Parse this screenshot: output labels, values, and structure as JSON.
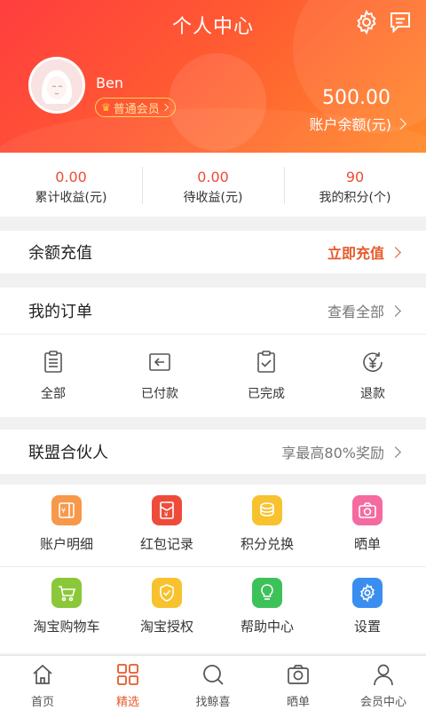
{
  "header": {
    "title": "个人中心",
    "username": "Ben",
    "member_level": "普通会员",
    "balance": "500.00",
    "balance_label": "账户余额(元)"
  },
  "stats": [
    {
      "value": "0.00",
      "label": "累计收益(元)"
    },
    {
      "value": "0.00",
      "label": "待收益(元)"
    },
    {
      "value": "90",
      "label": "我的积分(个)"
    }
  ],
  "recharge": {
    "label": "余额充值",
    "action": "立即充值"
  },
  "orders": {
    "label": "我的订单",
    "view_all": "查看全部",
    "items": [
      {
        "label": "全部",
        "icon": "clipboard-list-icon"
      },
      {
        "label": "已付款",
        "icon": "paid-return-icon"
      },
      {
        "label": "已完成",
        "icon": "clipboard-check-icon"
      },
      {
        "label": "退款",
        "icon": "yen-refund-icon"
      }
    ]
  },
  "partner": {
    "label": "联盟合伙人",
    "action": "享最高80%奖励"
  },
  "grid": [
    {
      "label": "账户明细",
      "icon": "account-detail-icon",
      "color": "#f7984a"
    },
    {
      "label": "红包记录",
      "icon": "red-packet-icon",
      "color": "#ef4b3a"
    },
    {
      "label": "积分兑换",
      "icon": "coins-icon",
      "color": "#f7c22e"
    },
    {
      "label": "晒单",
      "icon": "camera-icon",
      "color": "#f56aa0"
    },
    {
      "label": "淘宝购物车",
      "icon": "cart-icon",
      "color": "#8ac83a"
    },
    {
      "label": "淘宝授权",
      "icon": "shield-check-icon",
      "color": "#f7c22e"
    },
    {
      "label": "帮助中心",
      "icon": "lightbulb-icon",
      "color": "#3dc25a"
    },
    {
      "label": "设置",
      "icon": "gear-icon",
      "color": "#3a8ef0"
    }
  ],
  "tabs": [
    {
      "label": "首页",
      "icon": "home-icon"
    },
    {
      "label": "精选",
      "icon": "grid-icon",
      "active": true
    },
    {
      "label": "找鲸喜",
      "icon": "search-icon"
    },
    {
      "label": "晒单",
      "icon": "camera-icon"
    },
    {
      "label": "会员中心",
      "icon": "user-icon"
    }
  ],
  "colors": {
    "accent": "#e55a2b",
    "header_start": "#ff3d3f",
    "header_end": "#ff8a2a",
    "value_red": "#ef4b3a"
  }
}
